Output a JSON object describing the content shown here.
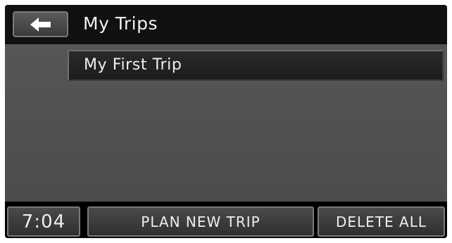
{
  "header": {
    "back_icon": "left-arrow-icon",
    "title": "My Trips"
  },
  "trips": {
    "items": [
      {
        "label": "My First Trip"
      }
    ]
  },
  "footer": {
    "clock": "7:04",
    "plan_new_trip_label": "PLAN NEW TRIP",
    "delete_all_label": "DELETE ALL"
  },
  "colors": {
    "screen_background": "#000000",
    "list_background": "#525252",
    "button_border": "#7a7a7a",
    "text": "#f0f0f0"
  }
}
